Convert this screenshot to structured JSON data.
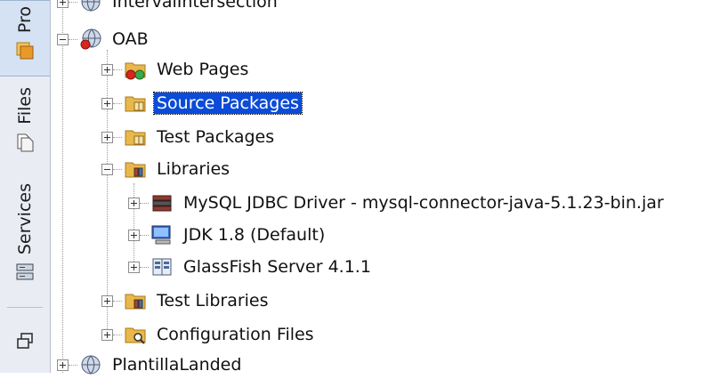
{
  "side_tabs": {
    "projects_label": "Pro",
    "files_label": "Files",
    "services_label": "Services"
  },
  "tree": {
    "top_partial": "IntervalIntersection",
    "project": "OAB",
    "nodes": {
      "web_pages": "Web Pages",
      "source_packages": "Source Packages",
      "test_packages": "Test Packages",
      "libraries": "Libraries",
      "lib_mysql": "MySQL JDBC Driver - mysql-connector-java-5.1.23-bin.jar",
      "lib_jdk": "JDK 1.8 (Default)",
      "lib_glassfish": "GlassFish Server 4.1.1",
      "test_libraries": "Test Libraries",
      "configuration_files": "Configuration Files"
    },
    "bottom_partial": "PlantillaLanded"
  },
  "selected_node": "Source Packages",
  "colors": {
    "selection": "#0b4bd8",
    "folder": "#e9b84a",
    "strip_bg": "#e9edf3"
  }
}
